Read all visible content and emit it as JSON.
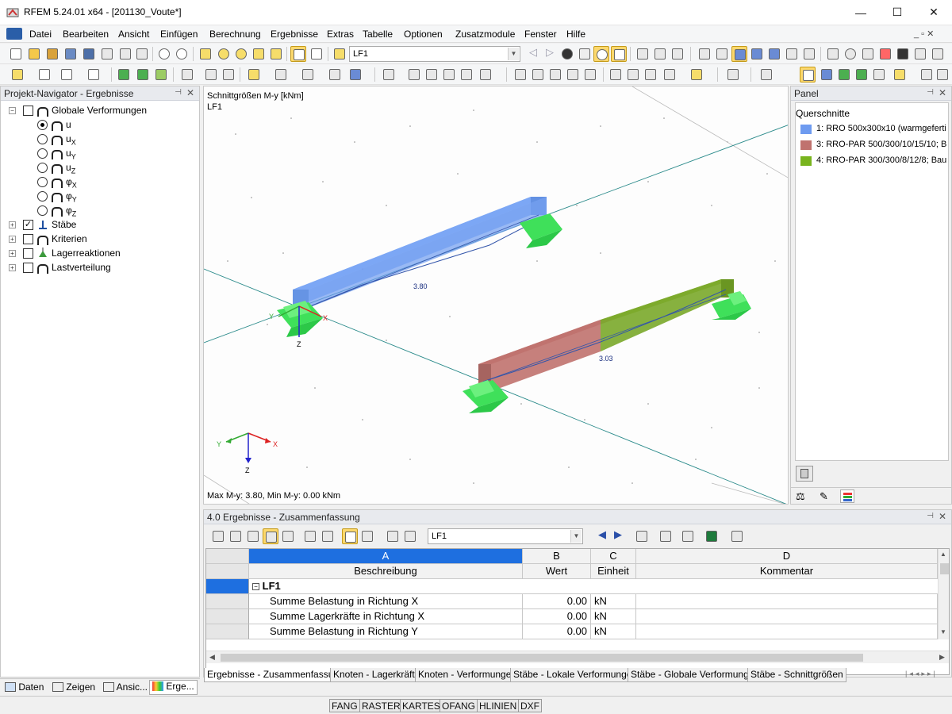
{
  "window": {
    "title": "RFEM 5.24.01 x64 - [201130_Voute*]",
    "minimize": "—",
    "maximize": "☐",
    "close": "✕"
  },
  "menu": [
    "Datei",
    "Bearbeiten",
    "Ansicht",
    "Einfügen",
    "Berechnung",
    "Ergebnisse",
    "Extras",
    "Tabelle",
    "Optionen",
    "Zusatzmodule",
    "Fenster",
    "Hilfe"
  ],
  "toolbar": {
    "loadcase_combo": "LF1"
  },
  "navigator": {
    "title": "Projekt-Navigator - Ergebnisse",
    "root": "Globale Verformungen",
    "options": [
      {
        "label": "u",
        "sub": "",
        "selected": true
      },
      {
        "label": "u",
        "sub": "X",
        "selected": false
      },
      {
        "label": "u",
        "sub": "Y",
        "selected": false
      },
      {
        "label": "u",
        "sub": "Z",
        "selected": false
      },
      {
        "label": "φ",
        "sub": "X",
        "selected": false
      },
      {
        "label": "φ",
        "sub": "Y",
        "selected": false
      },
      {
        "label": "φ",
        "sub": "Z",
        "selected": false
      }
    ],
    "groups": [
      {
        "label": "Stäbe",
        "checked": true
      },
      {
        "label": "Kriterien",
        "checked": false
      },
      {
        "label": "Lagerreaktionen",
        "checked": false
      },
      {
        "label": "Lastverteilung",
        "checked": false
      }
    ],
    "bottom_tabs": [
      "Daten",
      "Zeigen",
      "Ansic...",
      "Erge..."
    ]
  },
  "viewport": {
    "title": "Schnittgrößen M-y [kNm]",
    "loadcase": "LF1",
    "value_beam1": "3.80",
    "value_beam2": "3.03",
    "summary": "Max M-y: 3.80, Min M-y: 0.00 kNm",
    "axis_x": "X",
    "axis_y": "Y",
    "axis_z": "Z"
  },
  "panel": {
    "title": "Panel",
    "section_title": "Querschnitte",
    "items": [
      {
        "label": "1: RRO 500x300x10 (warmgeferti",
        "color": "#6e9bf0"
      },
      {
        "label": "3: RRO-PAR 500/300/10/15/10; B",
        "color": "#c0726e"
      },
      {
        "label": "4: RRO-PAR 300/300/8/12/8; Bau",
        "color": "#78b41e"
      }
    ]
  },
  "results": {
    "title": "4.0 Ergebnisse - Zusammenfassung",
    "combo": "LF1",
    "columns": [
      {
        "letter": "A",
        "name": "Beschreibung"
      },
      {
        "letter": "B",
        "name": "Wert"
      },
      {
        "letter": "C",
        "name": "Einheit"
      },
      {
        "letter": "D",
        "name": "Kommentar"
      }
    ],
    "group": "LF1",
    "rows": [
      {
        "desc": "Summe Belastung in Richtung X",
        "value": "0.00",
        "unit": "kN"
      },
      {
        "desc": "Summe Lagerkräfte in Richtung X",
        "value": "0.00",
        "unit": "kN"
      },
      {
        "desc": "Summe Belastung in Richtung Y",
        "value": "0.00",
        "unit": "kN"
      }
    ],
    "tabs": [
      "Ergebnisse - Zusammenfassung",
      "Knoten - Lagerkräfte",
      "Knoten - Verformungen",
      "Stäbe - Lokale Verformungen",
      "Stäbe - Globale Verformungen",
      "Stäbe - Schnittgrößen"
    ]
  },
  "statusbar": [
    "FANG",
    "RASTER",
    "KARTES",
    "OFANG",
    "HLINIEN",
    "DXF"
  ]
}
